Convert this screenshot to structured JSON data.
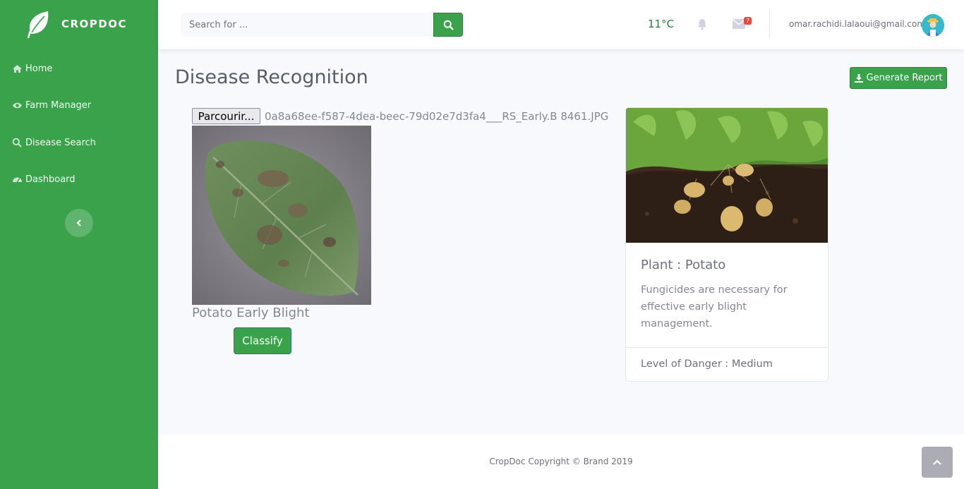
{
  "brand": {
    "name": "CROPDOC"
  },
  "sidebar": {
    "items": [
      {
        "label": "Home",
        "icon": "home-icon"
      },
      {
        "label": "Farm Manager",
        "icon": "eye-icon"
      },
      {
        "label": "Disease Search",
        "icon": "search-icon"
      },
      {
        "label": "Dashboard",
        "icon": "tachometer-icon"
      }
    ],
    "toggle_icon": "chevron-left-icon"
  },
  "topbar": {
    "search_placeholder": "Search for ...",
    "temperature": "11°C",
    "mail_badge": "7",
    "user_email": "omar.rachidi.lalaoui@gmail.com"
  },
  "main": {
    "title": "Disease Recognition",
    "report_button": "Generate Report",
    "file_button": "Parcourir...",
    "file_name": "0a8a68ee-f587-4dea-beec-79d02e7d3fa4___RS_Early.B 8461.JPG",
    "result": "Potato Early Blight",
    "classify_button": "Classify"
  },
  "card": {
    "title": "Plant : Potato",
    "text": "Fungicides are necessary for effective early blight management.",
    "footer": "Level of Danger : Medium"
  },
  "footer": {
    "copyright": "CropDoc Copyright © Brand 2019"
  },
  "colors": {
    "accent": "#3aa24b",
    "badge": "#e74a3b",
    "temperature": "#2c7a38"
  }
}
